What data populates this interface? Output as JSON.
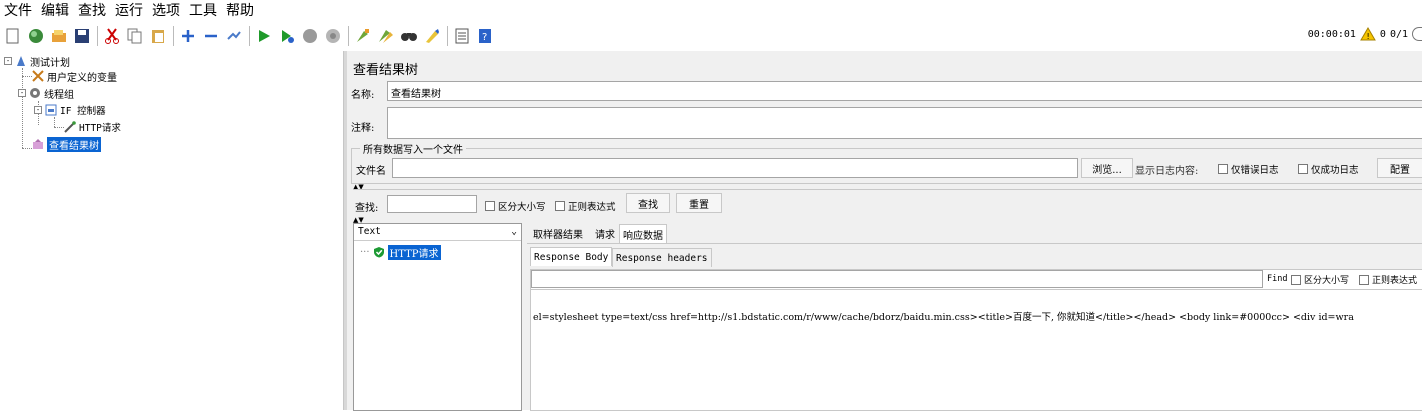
{
  "menu": [
    "文件",
    "编辑",
    "查找",
    "运行",
    "选项",
    "工具",
    "帮助"
  ],
  "status": {
    "time": "00:00:01",
    "count": "0",
    "ratio": "0/1"
  },
  "tree": {
    "root": "测试计划",
    "user_vars": "用户定义的变量",
    "thread_group": "线程组",
    "if_ctrl": "IF 控制器",
    "http": "HTTP请求",
    "result_tree": "查看结果树"
  },
  "panel": {
    "title": "查看结果树",
    "name_label": "名称:",
    "name_value": "查看结果树",
    "comment_label": "注释:",
    "group_title": "所有数据写入一个文件",
    "file_label": "文件名",
    "browse": "浏览...",
    "log_label": "显示日志内容:",
    "err_only": "仅错误日志",
    "ok_only": "仅成功日志",
    "config": "配置",
    "search_label": "查找:",
    "case": "区分大小写",
    "regex": "正则表达式",
    "find_btn": "查找",
    "reset_btn": "重置"
  },
  "results": {
    "renderer": "Text",
    "sample": "HTTP请求",
    "tabs": [
      "取样器结果",
      "请求",
      "响应数据"
    ],
    "subtabs": [
      "Response Body",
      "Response headers"
    ],
    "find": "Find",
    "case": "区分大小写",
    "regex": "正则表达式",
    "body": "el=stylesheet type=text/css href=http://s1.bdstatic.com/r/www/cache/bdorz/baidu.min.css><title>百度一下, 你就知道</title></head> <body link=#0000cc> <div id=wra"
  }
}
